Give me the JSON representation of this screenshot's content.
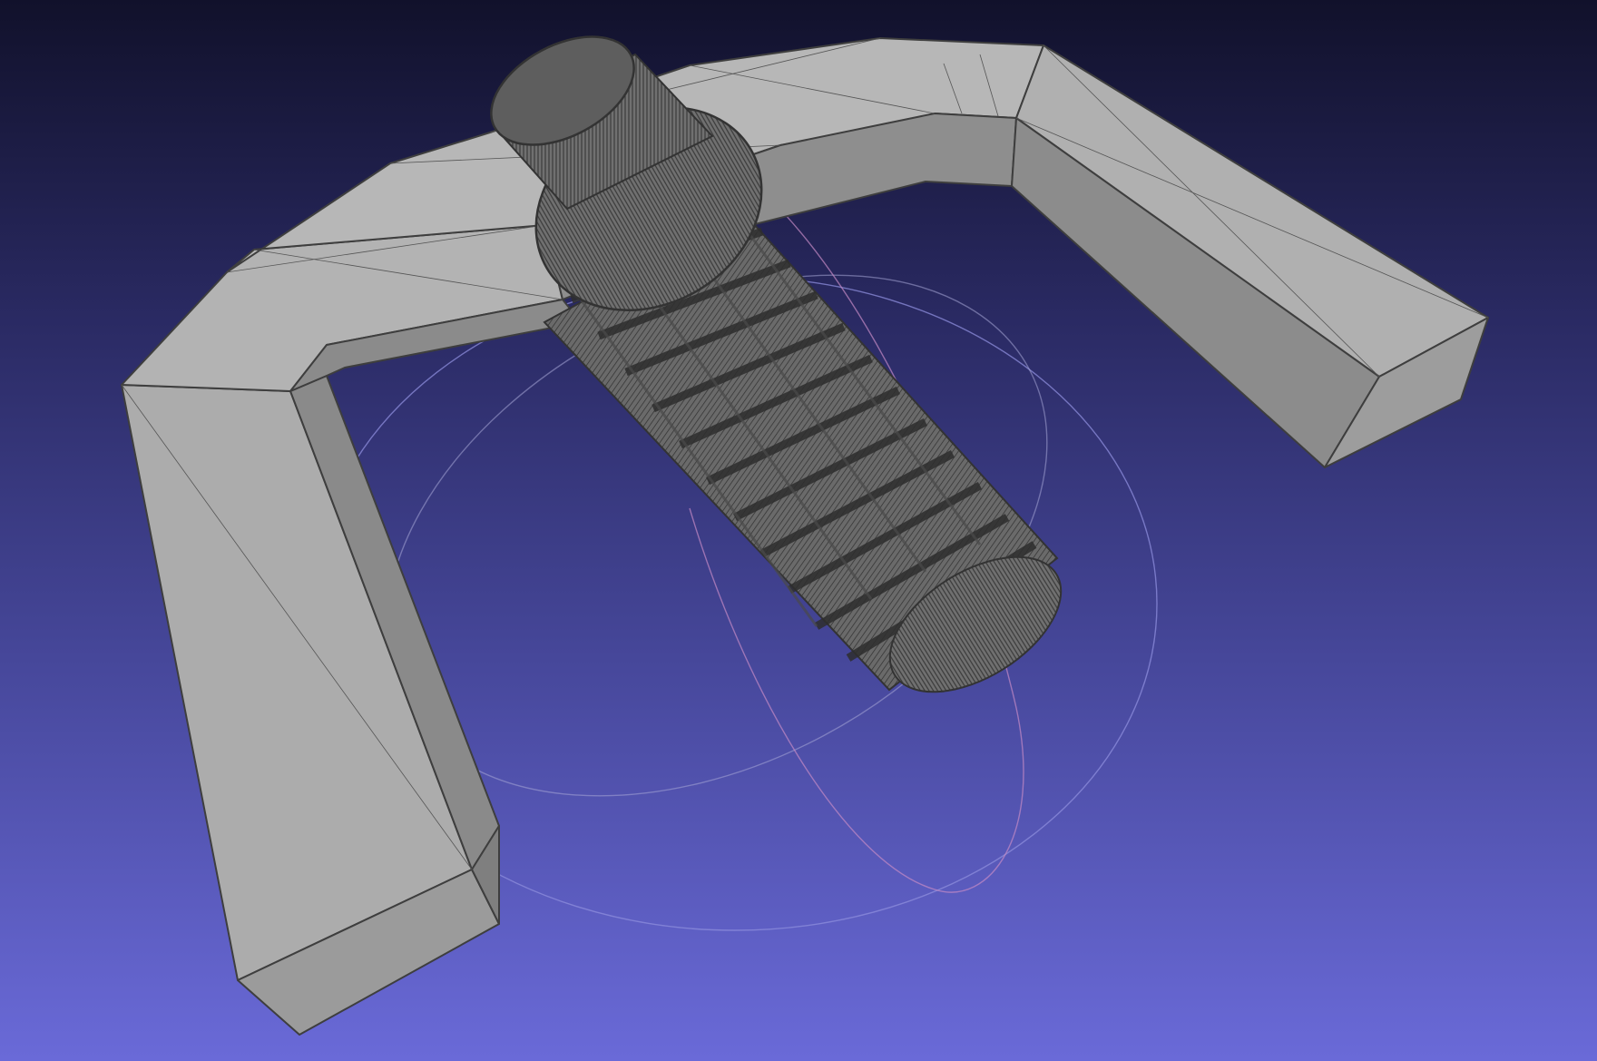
{
  "viewer": {
    "background_top": "#11112b",
    "background_bottom": "#6a6ad8",
    "render_mode": "flat-lines",
    "mesh_face_color": "#a9a9a9",
    "mesh_edge_color": "#3e3e3e",
    "trackball_colors": [
      "#8d8ddc",
      "#c48ac4",
      "#a6a6d6"
    ]
  },
  "scene": {
    "objects": [
      {
        "name": "bracket",
        "icon": "bracket-mesh"
      },
      {
        "name": "threaded-screw",
        "icon": "screw-mesh"
      }
    ],
    "trackball": {
      "visible": true,
      "icon": "trackball-rings"
    }
  }
}
